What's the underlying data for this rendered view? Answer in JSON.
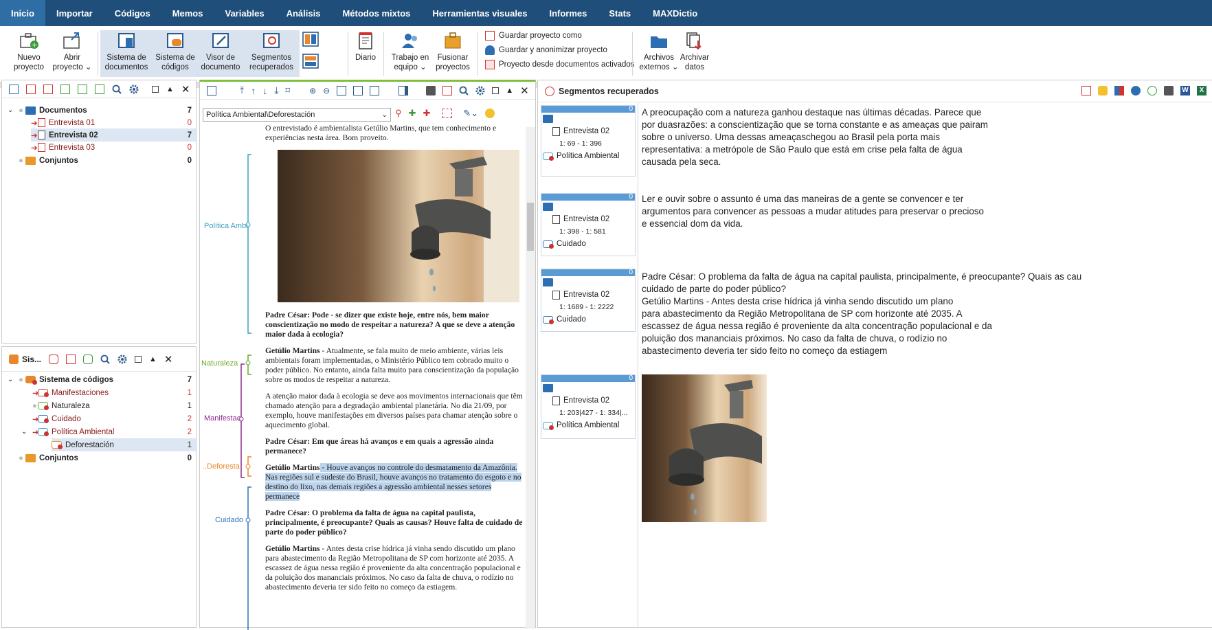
{
  "menu": [
    "Inicio",
    "Importar",
    "Códigos",
    "Memos",
    "Variables",
    "Análisis",
    "Métodos mixtos",
    "Herramientas visuales",
    "Informes",
    "Stats",
    "MAXDictio"
  ],
  "ribbon": {
    "nuevo": [
      "Nuevo",
      "proyecto"
    ],
    "abrir": [
      "Abrir",
      "proyecto ⌄"
    ],
    "sisdoc": [
      "Sistema de",
      "documentos"
    ],
    "siscod": [
      "Sistema de",
      "códigos"
    ],
    "visor": [
      "Visor de",
      "documento"
    ],
    "segmentos": [
      "Segmentos",
      "recuperados"
    ],
    "diario": [
      "Diario"
    ],
    "trabajo": [
      "Trabajo en",
      "equipo ⌄"
    ],
    "fusionar": [
      "Fusionar",
      "proyectos"
    ],
    "guardar_como": "Guardar proyecto como",
    "guardar_anon": "Guardar y anonimizar proyecto",
    "proyecto_desde": "Proyecto desde documentos activados",
    "archivos": [
      "Archivos",
      "externos ⌄"
    ],
    "archivar": [
      "Archivar",
      "datos"
    ]
  },
  "docs_panel": {
    "root": "Documentos",
    "root_count": "7",
    "items": [
      {
        "label": "Entrevista 01",
        "count": "0"
      },
      {
        "label": "Entrevista 02",
        "count": "7"
      },
      {
        "label": "Entrevista 03",
        "count": "0"
      }
    ],
    "conjuntos": "Conjuntos",
    "conjuntos_count": "0"
  },
  "codes_panel": {
    "title": "Sis...",
    "root": "Sistema de códigos",
    "root_count": "7",
    "items": [
      {
        "label": "Manifestaciones",
        "count": "1",
        "color": "#c0392b"
      },
      {
        "label": "Naturaleza",
        "count": "1",
        "color": "#6aaa2a"
      },
      {
        "label": "Cuidado",
        "count": "2",
        "color": "#2e75b6"
      },
      {
        "label": "Política Ambiental",
        "count": "2",
        "color": "#3aa0c0"
      },
      {
        "label": "Deforestación",
        "count": "1",
        "color": "#e8872b"
      }
    ],
    "conjuntos": "Conjuntos",
    "conjuntos_count": "0"
  },
  "viewer": {
    "dropdown": "Política Ambiental\\Deforestación",
    "code_labels": [
      "Política Ambi",
      "Naturaleza",
      "Manifestac",
      "..Deforesta",
      "Cuidado"
    ],
    "paragraphs": [
      {
        "text": "O entrevistado é ambientalista Getúlio Martins, que tem conhecimento e experiências nesta área. Bom proveito."
      },
      {
        "text": "Padre César: Pode - se dizer que existe hoje, entre nós, bem maior conscientização no modo de respeitar a natureza?  A que se deve a atenção maior dada à ecologia?"
      },
      {
        "speaker": "Getúlio Martins",
        "text": " - Atualmente, se fala muito de meio ambiente, várias leis ambientais foram implementadas, o Ministério Público tem cobrado muito o poder público. No entanto, ainda falta muito para conscientização da população sobre os modos de respeitar a natureza."
      },
      {
        "text": "A atenção maior dada à ecologia se deve aos movimentos internacionais que têm chamado atenção para a degradação ambiental planetária.  No dia 21/09, por exemplo, houve manifestações em diversos países para chamar atenção sobre o aquecimento global."
      },
      {
        "text": "Padre César: Em que áreas há avanços e em quais a agressão ainda permanece?"
      },
      {
        "speaker": "Getúlio Martins",
        "text": " - Houve avanços no controle do desmatamento da Amazônia. Nas regiões sul e sudeste do Brasil, houve avanços no tratamento do esgoto e no destino do lixo, nas demais regiões a agressão ambiental nesses setores permanece"
      },
      {
        "text": "Padre César: O problema da falta de água na capital paulista, principalmente, é preocupante? Quais as causas? Houve falta de cuidado de parte do poder público?"
      },
      {
        "speaker": "Getúlio Martins",
        "text": " - Antes desta crise hídrica já vinha sendo discutido um plano para abastecimento da Região Metropolitana de SP com horizonte até 2035. A escassez de água nessa região é proveniente da alta concentração populacional e da poluição dos mananciais próximos. No caso da falta de chuva, o rodízio no abastecimento deveria ter sido feito no começo da estiagem."
      }
    ]
  },
  "segments": {
    "title": "Segmentos recuperados",
    "cards": [
      {
        "count": "0",
        "doc": "Entrevista 02",
        "range": "1: 69 - 1: 396",
        "code": "Política Ambiental"
      },
      {
        "count": "0",
        "doc": "Entrevista 02",
        "range": "1: 398 - 1: 581",
        "code": "Cuidado"
      },
      {
        "count": "0",
        "doc": "Entrevista 02",
        "range": "1: 1689 - 1: 2222",
        "code": "Cuidado"
      },
      {
        "count": "0",
        "doc": "Entrevista 02",
        "range": "1: 203|427 - 1: 334|...",
        "code": "Política Ambiental"
      }
    ],
    "texts": [
      [
        "A preocupação com a natureza ganhou destaque nas últimas décadas. Parece que",
        "por duasrazões: a conscientização que se torna constante e as ameaças que pairam",
        "sobre o universo. Uma dessas ameaçaschegou ao Brasil pela porta mais",
        "representativa: a metrópole de São Paulo que está em crise pela falta de água",
        "causada pela seca."
      ],
      [
        "Ler e ouvir sobre o assunto é uma das maneiras de a gente se convencer e ter",
        "argumentos para convencer as pessoas a mudar atitudes para preservar o precioso",
        "e essencial dom da vida."
      ],
      [
        "Padre César: O problema da falta de água na capital paulista, principalmente, é preocupante? Quais as cau",
        "cuidado de parte do poder público?",
        "Getúlio Martins - Antes desta crise hídrica já vinha sendo discutido um plano",
        "para abastecimento da Região Metropolitana de SP com horizonte até 2035. A",
        "escassez de água nessa região é proveniente da alta concentração populacional e da",
        "poluição dos mananciais próximos. No caso da falta de chuva, o rodízio no",
        "abastecimento deveria ter sido feito no começo da estiagem"
      ]
    ]
  }
}
